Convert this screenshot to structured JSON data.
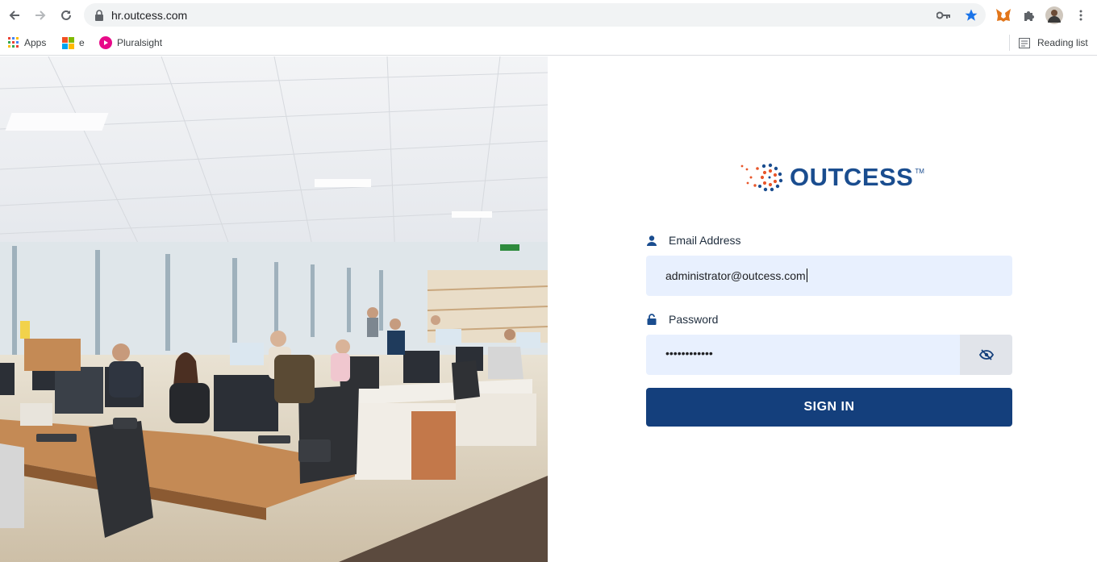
{
  "browser": {
    "url": "hr.outcess.com",
    "bookmarks": [
      {
        "label": "Apps",
        "icon": "apps-grid-icon"
      },
      {
        "label": "e",
        "icon": "microsoft-icon"
      },
      {
        "label": "Pluralsight",
        "icon": "pluralsight-icon"
      }
    ],
    "reading_list": "Reading list"
  },
  "login": {
    "logo_text": "OUTCESS",
    "logo_tm": "TM",
    "email_label": "Email Address",
    "email_value": "administrator@outcess.com",
    "password_label": "Password",
    "password_value": "••••••••••••",
    "signin_label": "SIGN IN"
  },
  "colors": {
    "brand_blue": "#143f7c",
    "input_bg": "#e8f0fe",
    "logo_orange": "#e8562a"
  }
}
